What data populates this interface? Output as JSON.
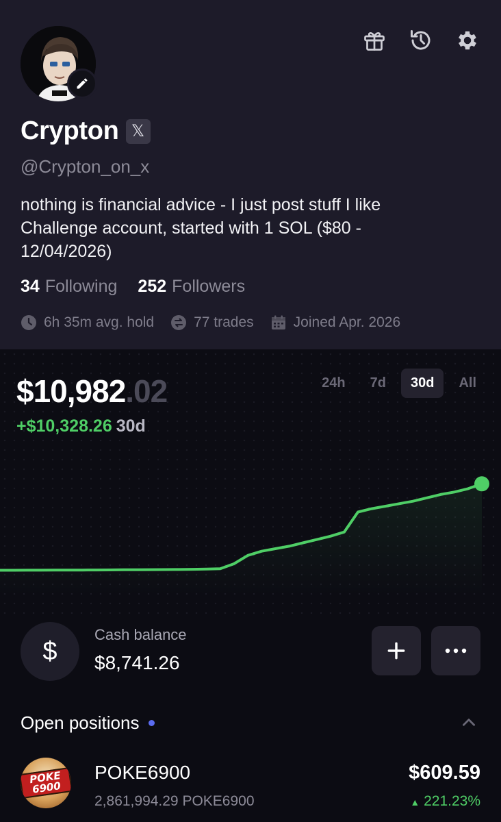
{
  "profile": {
    "name": "Crypton",
    "x_badge": "𝕏",
    "handle": "@Crypton_on_x",
    "bio_lines": [
      "nothing is financial advice - I just post stuff I like",
      "Challenge account, started with 1 SOL ($80 -",
      "12/04/2026)"
    ],
    "following_count": "34",
    "following_label": "Following",
    "followers_count": "252",
    "followers_label": "Followers",
    "stats": {
      "avg_hold": "6h 35m avg. hold",
      "trades": "77 trades",
      "joined": "Joined Apr. 2026"
    },
    "icons": [
      "gift-icon",
      "history-icon",
      "gear-icon",
      "pencil-icon",
      "x-logo-icon",
      "clock-icon",
      "swap-icon",
      "calendar-icon"
    ]
  },
  "portfolio": {
    "balance_whole": "$10,982",
    "balance_cents": ".02",
    "change_amount": "+$10,328.26",
    "change_period": "30d",
    "ranges": [
      "24h",
      "7d",
      "30d",
      "All"
    ],
    "active_range": "30d"
  },
  "chart_data": {
    "type": "line",
    "x": [
      0,
      1,
      2,
      3,
      4,
      5,
      6,
      7,
      8,
      9,
      10,
      11,
      12,
      13,
      14,
      15,
      16,
      17,
      18,
      19,
      20,
      21,
      22,
      23,
      24,
      25,
      26,
      27,
      28,
      29,
      30,
      31,
      32,
      33,
      34,
      35
    ],
    "values": [
      620,
      620,
      625,
      628,
      630,
      632,
      640,
      650,
      660,
      670,
      680,
      690,
      700,
      710,
      730,
      760,
      800,
      1400,
      2400,
      2900,
      3200,
      3500,
      3900,
      4300,
      4700,
      5200,
      7600,
      8000,
      8300,
      8600,
      8900,
      9300,
      9700,
      10000,
      10400,
      10982
    ],
    "ylim": [
      0,
      11500
    ],
    "line_color": "#4fce66",
    "grid": false
  },
  "cash": {
    "label": "Cash balance",
    "value": "$8,741.26",
    "currency_symbol": "$"
  },
  "positions": {
    "title": "Open positions",
    "items": [
      {
        "logo_text": "POKE 6900",
        "name": "POKE6900",
        "amount": "2,861,994.29 POKE6900",
        "value": "$609.59",
        "change": "221.23%"
      }
    ]
  },
  "colors": {
    "accent_green": "#4fce66",
    "dot_blue": "#5b6cf0",
    "panel": "#1d1b29",
    "background": "#0c0c13"
  }
}
